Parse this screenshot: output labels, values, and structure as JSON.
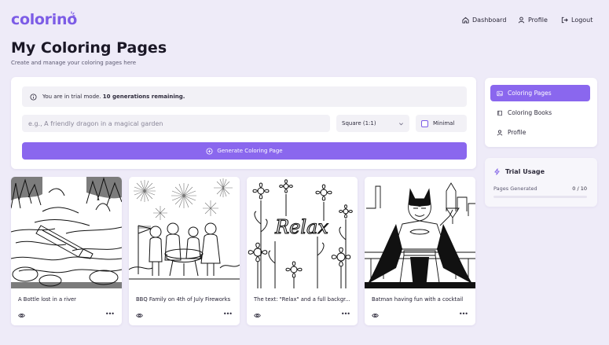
{
  "brand": {
    "name": "colorino",
    "accent": "#8a67ee"
  },
  "nav": {
    "dashboard": "Dashboard",
    "profile": "Profile",
    "logout": "Logout"
  },
  "header": {
    "title": "My Coloring Pages",
    "subtitle": "Create and manage your coloring pages here"
  },
  "generator": {
    "trial_notice_prefix": "You are in trial mode. ",
    "trial_notice_count": "10 generations remaining.",
    "prompt_placeholder": "e.g., A friendly dragon in a magical garden",
    "size_value": "Square (1:1)",
    "minimal_label": "Minimal",
    "minimal_checked": false,
    "generate_label": "Generate Coloring Page"
  },
  "sidebar": {
    "items": [
      {
        "label": "Coloring Pages",
        "icon": "image-icon",
        "active": true
      },
      {
        "label": "Coloring Books",
        "icon": "book-icon",
        "active": false
      },
      {
        "label": "Profile",
        "icon": "user-icon",
        "active": false
      }
    ]
  },
  "usage": {
    "title": "Trial Usage",
    "label": "Pages Generated",
    "value": "0 / 10",
    "fraction": 0
  },
  "cards": [
    {
      "title": "A Bottle lost in a river",
      "image": "bottle-river-drawing"
    },
    {
      "title": "BBQ Family on 4th of July Fireworks",
      "image": "bbq-family-drawing"
    },
    {
      "title": "The text: \"Relax\" and a full backgr...",
      "image": "relax-flowers-drawing",
      "image_text": "Relax"
    },
    {
      "title": "Batman having fun with a cocktail",
      "image": "batman-cocktail-drawing"
    }
  ]
}
